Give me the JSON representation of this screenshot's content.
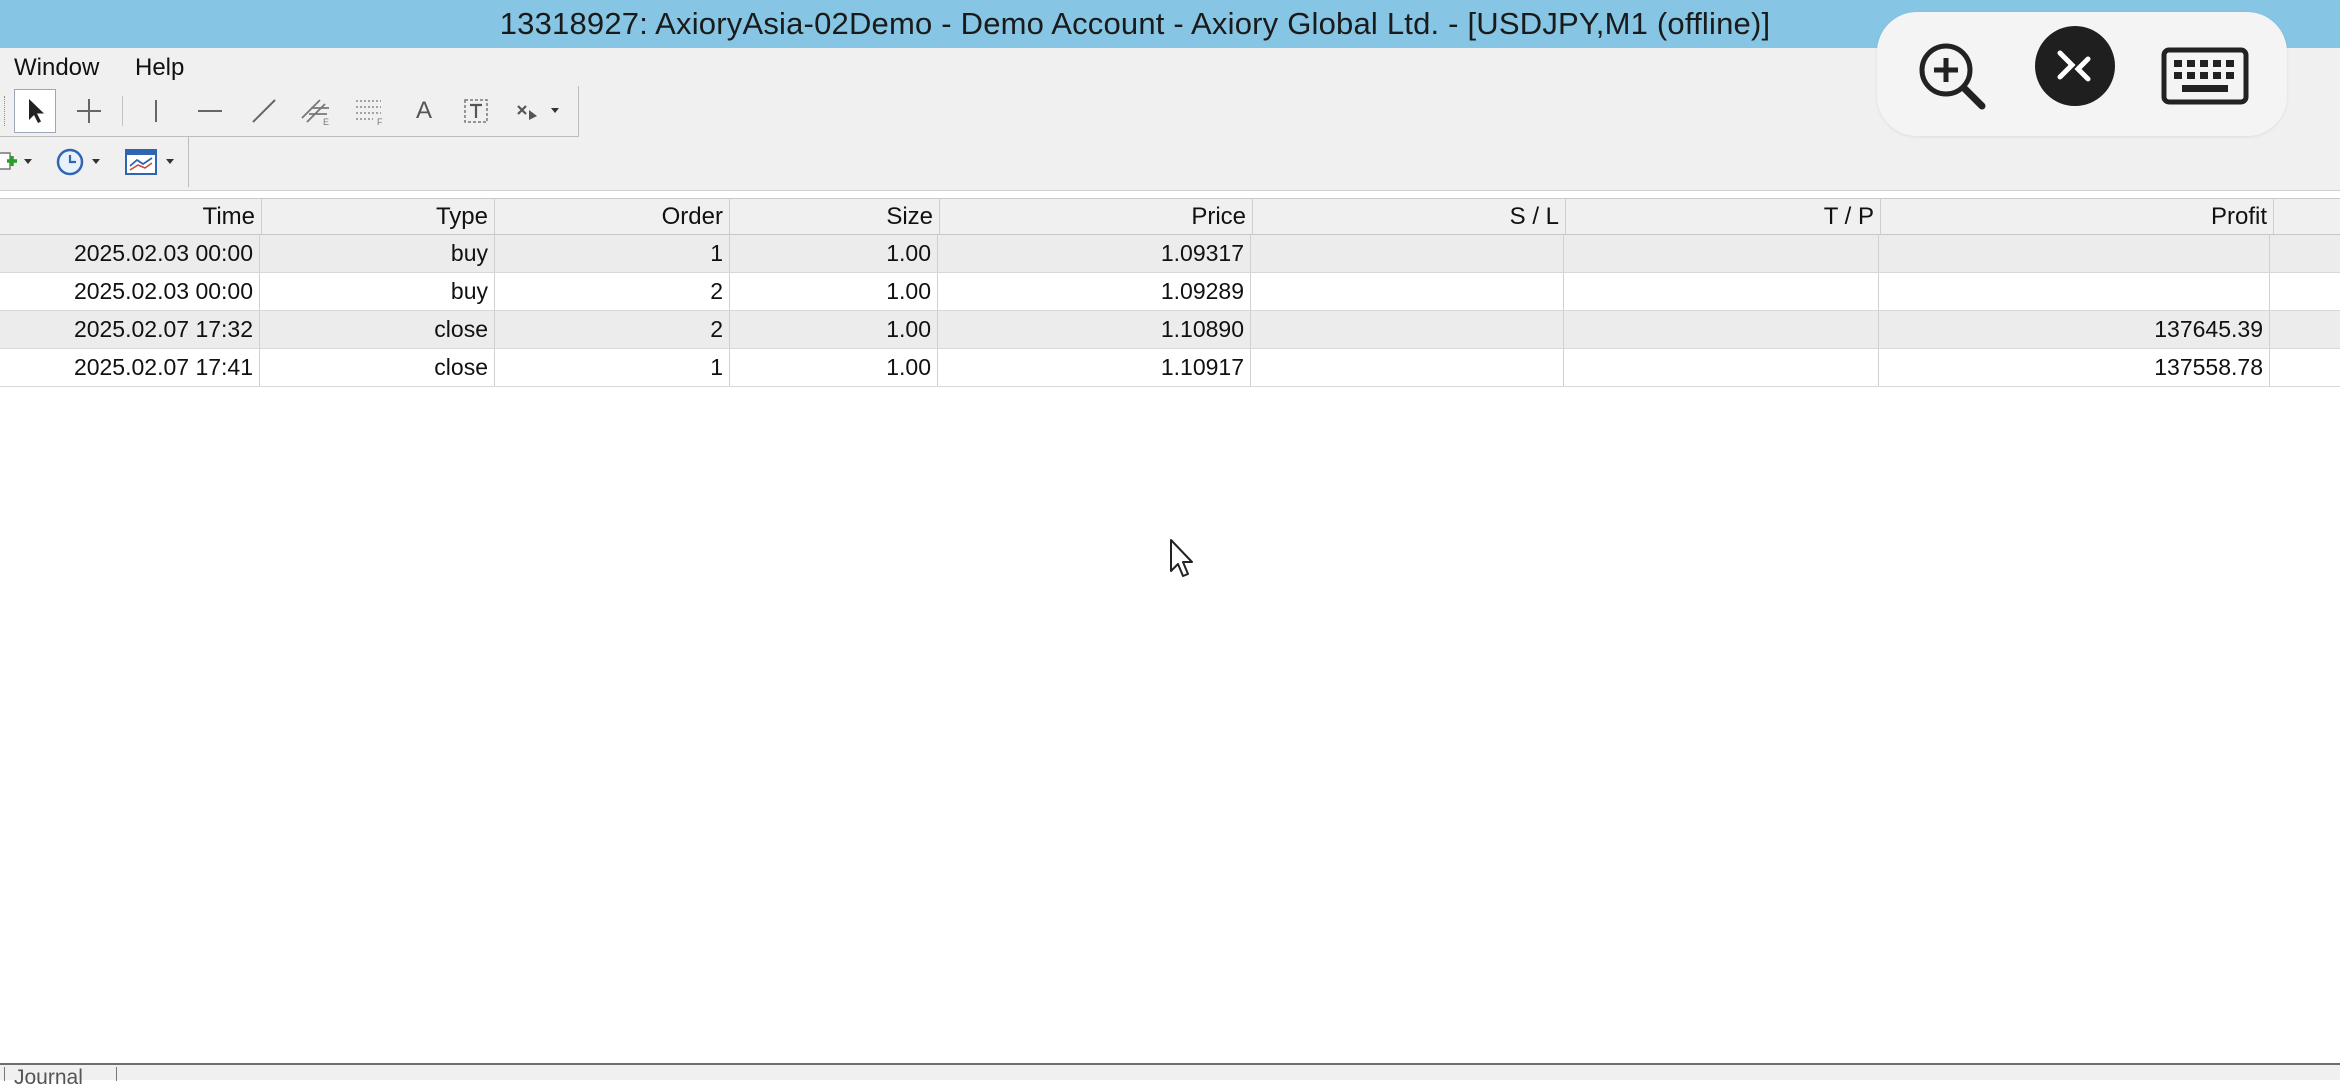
{
  "window": {
    "title": "13318927: AxioryAsia-02Demo - Demo Account - Axiory Global Ltd. - [USDJPY,M1 (offline)]"
  },
  "menu": {
    "items": [
      "Window",
      "Help"
    ]
  },
  "toolbar": {
    "line_studies": [
      "cursor-arrow",
      "crosshair",
      "vertical-line",
      "horizontal-line",
      "trend-line",
      "equidistant-channel",
      "fibonacci-retracement",
      "text",
      "text-label",
      "arrows-dropdown"
    ],
    "charts": [
      "new-chart-dropdown",
      "periods-dropdown",
      "templates-dropdown"
    ],
    "text_icon": "A"
  },
  "overlay": {
    "buttons": [
      "zoom-in-icon",
      "remote-connect-icon",
      "keyboard-icon"
    ]
  },
  "table": {
    "columns": [
      "Time",
      "Type",
      "Order",
      "Size",
      "Price",
      "S / L",
      "T / P",
      "Profit"
    ],
    "rows": [
      {
        "time": "2025.02.03 00:00",
        "type": "buy",
        "order": "1",
        "size": "1.00",
        "price": "1.09317",
        "sl": "",
        "tp": "",
        "profit": ""
      },
      {
        "time": "2025.02.03 00:00",
        "type": "buy",
        "order": "2",
        "size": "1.00",
        "price": "1.09289",
        "sl": "",
        "tp": "",
        "profit": ""
      },
      {
        "time": "2025.02.07 17:32",
        "type": "close",
        "order": "2",
        "size": "1.00",
        "price": "1.10890",
        "sl": "",
        "tp": "",
        "profit": "137645.39"
      },
      {
        "time": "2025.02.07 17:41",
        "type": "close",
        "order": "1",
        "size": "1.00",
        "price": "1.10917",
        "sl": "",
        "tp": "",
        "profit": "137558.78"
      }
    ]
  },
  "bottom": {
    "tab_label": "Journal"
  },
  "colors": {
    "titlebar": "#86c5e3",
    "row_shaded": "#ececec",
    "toolbar_bg": "#f0f0f0"
  }
}
